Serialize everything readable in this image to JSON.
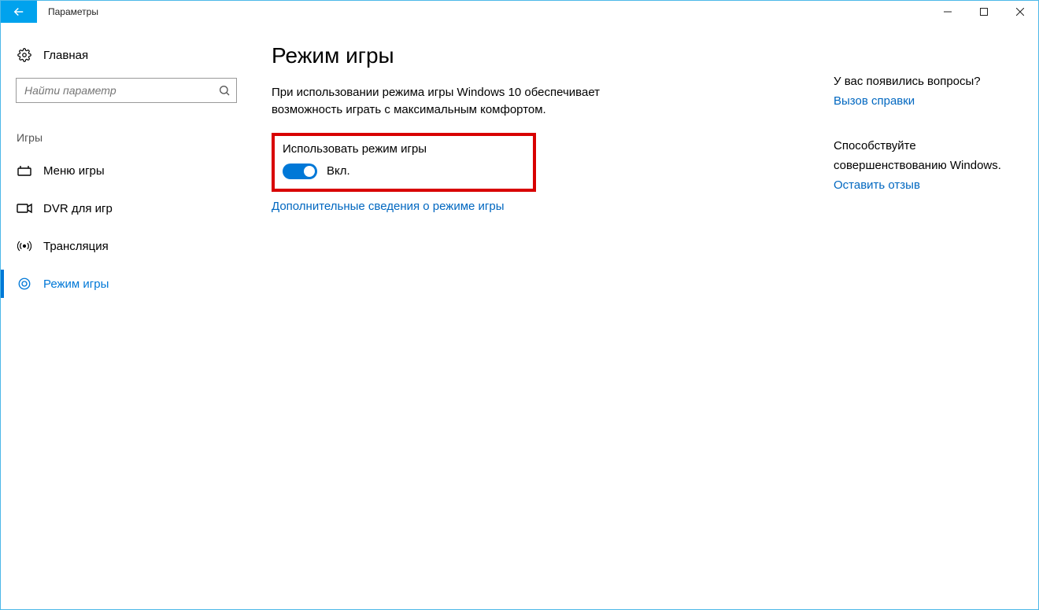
{
  "window": {
    "title": "Параметры"
  },
  "sidebar": {
    "home": "Главная",
    "search_placeholder": "Найти параметр",
    "section": "Игры",
    "items": [
      {
        "label": "Меню игры"
      },
      {
        "label": "DVR для игр"
      },
      {
        "label": "Трансляция"
      },
      {
        "label": "Режим игры"
      }
    ]
  },
  "main": {
    "title": "Режим игры",
    "description": "При использовании режима игры Windows 10 обеспечивает возможность играть с максимальным комфортом.",
    "toggle_label": "Использовать режим игры",
    "toggle_state": "Вкл.",
    "more_link": "Дополнительные сведения о режиме игры"
  },
  "right": {
    "questions_title": "У вас появились вопросы?",
    "help_link": "Вызов справки",
    "improve_title1": "Способствуйте",
    "improve_title2": "совершенствованию Windows.",
    "feedback_link": "Оставить отзыв"
  }
}
